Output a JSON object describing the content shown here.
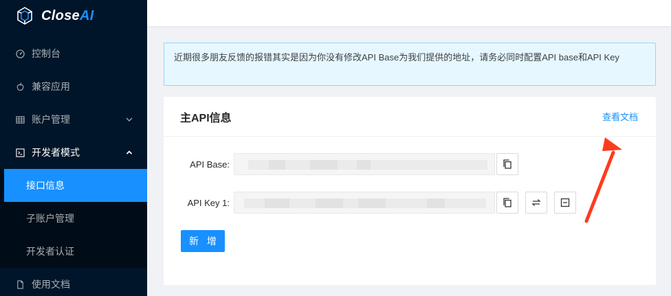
{
  "brand": {
    "name_a": "Close",
    "name_b": "AI"
  },
  "sidebar": {
    "items": [
      {
        "label": "控制台",
        "icon": "dashboard-icon"
      },
      {
        "label": "兼容应用",
        "icon": "apple-icon"
      },
      {
        "label": "账户管理",
        "icon": "table-icon",
        "expandable": true
      },
      {
        "label": "开发者模式",
        "icon": "code-icon",
        "expanded": true
      }
    ],
    "sub_items": [
      {
        "label": "接口信息",
        "active": true
      },
      {
        "label": "子账户管理"
      },
      {
        "label": "开发者认证"
      }
    ],
    "docs": {
      "label": "使用文档",
      "icon": "file-icon"
    }
  },
  "alert": {
    "text": "近期很多朋友反馈的报错其实是因为你没有修改API Base为我们提供的地址，请务必同时配置API base和API Key"
  },
  "card": {
    "title": "主API信息",
    "doc_link": "查看文档",
    "api_base_label": "API Base",
    "api_key_label": "API Key 1",
    "add_button": "新 增"
  },
  "colors": {
    "primary": "#1890ff",
    "sidebar_bg": "#001529",
    "annotation": "#ff3b1f"
  }
}
